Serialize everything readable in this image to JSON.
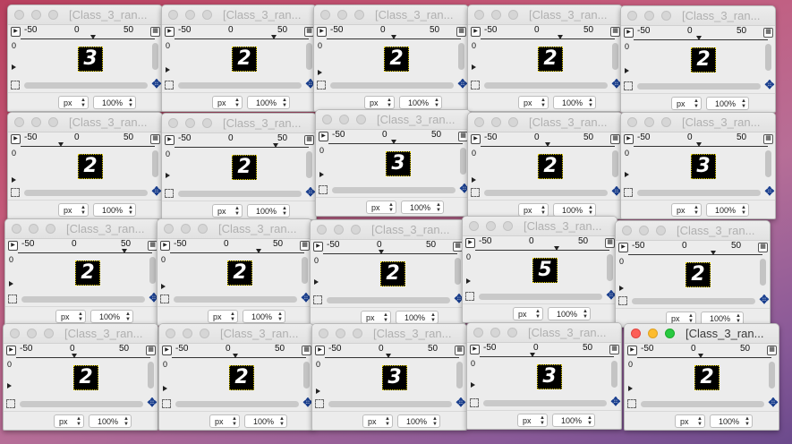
{
  "colors": {
    "desktop_gradient": [
      "#b9415f",
      "#c45a7a",
      "#b76e97",
      "#8a5a98",
      "#6b4a8c"
    ],
    "digit_outline": "#e6d200",
    "move_icon": "#1a3f8f"
  },
  "window_common": {
    "title": "[Class_3_ran...",
    "ruler_labels": [
      "-50",
      "0",
      "50"
    ],
    "vruler_label": "0",
    "unit": "px",
    "zoom": "100%",
    "icons": [
      "toggle-icon",
      "zoom-fit-icon",
      "move-icon",
      "corner-icon"
    ]
  },
  "windows": [
    {
      "digit": "3"
    },
    {
      "digit": "2"
    },
    {
      "digit": "2"
    },
    {
      "digit": "2"
    },
    {
      "digit": "2"
    },
    {
      "digit": "2"
    },
    {
      "digit": "2"
    },
    {
      "digit": "3"
    },
    {
      "digit": "2"
    },
    {
      "digit": "3"
    },
    {
      "digit": "2"
    },
    {
      "digit": "2"
    },
    {
      "digit": "2"
    },
    {
      "digit": "5"
    },
    {
      "digit": "2"
    },
    {
      "digit": "2"
    },
    {
      "digit": "2"
    },
    {
      "digit": "3"
    },
    {
      "digit": "3"
    },
    {
      "digit": "2",
      "active": true
    }
  ]
}
